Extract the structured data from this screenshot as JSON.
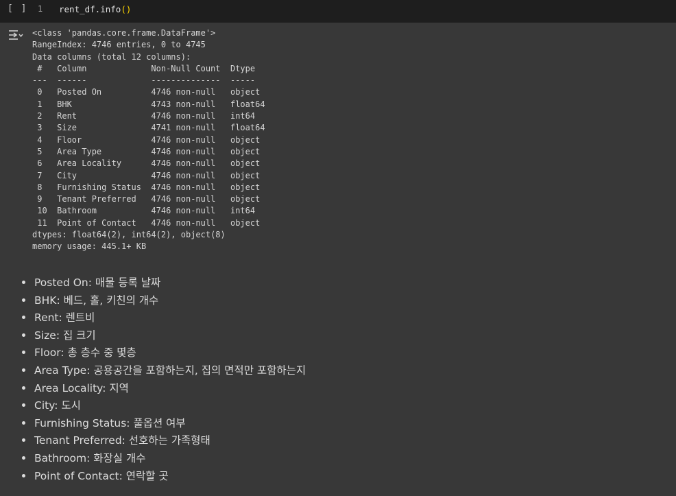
{
  "code_cell": {
    "run_label": "[ ]",
    "line_number": "1",
    "code": "rent_df.info",
    "code_parens": "()"
  },
  "output": {
    "lines": [
      "<class 'pandas.core.frame.DataFrame'>",
      "RangeIndex: 4746 entries, 0 to 4745",
      "Data columns (total 12 columns):",
      " #   Column             Non-Null Count  Dtype  ",
      "---  ------             --------------  -----  ",
      " 0   Posted On          4746 non-null   object ",
      " 1   BHK                4743 non-null   float64",
      " 2   Rent               4746 non-null   int64  ",
      " 3   Size               4741 non-null   float64",
      " 4   Floor              4746 non-null   object ",
      " 5   Area Type          4746 non-null   object ",
      " 6   Area Locality      4746 non-null   object ",
      " 7   City               4746 non-null   object ",
      " 8   Furnishing Status  4746 non-null   object ",
      " 9   Tenant Preferred   4746 non-null   object ",
      " 10  Bathroom           4746 non-null   int64  ",
      " 11  Point of Contact   4746 non-null   object ",
      "dtypes: float64(2), int64(2), object(8)",
      "memory usage: 445.1+ KB"
    ]
  },
  "bullets": [
    "Posted On: 매물 등록 날짜",
    "BHK: 베드, 홀, 키친의 개수",
    "Rent: 렌트비",
    "Size: 집 크기",
    "Floor: 총 층수 중 몇층",
    "Area Type: 공용공간을 포함하는지, 집의 면적만 포함하는지",
    "Area Locality: 지역",
    "City: 도시",
    "Furnishing Status: 풀옵션 여부",
    "Tenant Preferred: 선호하는 가족형태",
    "Bathroom: 화장실 개수",
    "Point of Contact: 연락할 곳"
  ]
}
